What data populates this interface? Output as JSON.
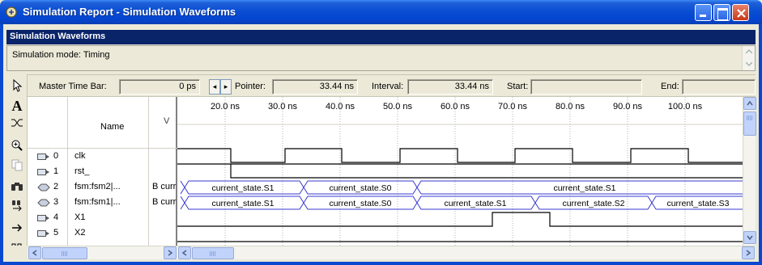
{
  "window": {
    "title": "Simulation Report - Simulation Waveforms"
  },
  "section": {
    "header": "Simulation Waveforms",
    "mode": "Simulation mode: Timing"
  },
  "timebar": {
    "master_label": "Master Time Bar:",
    "master_value": "0 ps",
    "pointer_label": "Pointer:",
    "pointer_value": "33.44 ns",
    "interval_label": "Interval:",
    "interval_value": "33.44 ns",
    "start_label": "Start:",
    "start_value": "",
    "end_label": "End:",
    "end_value": ""
  },
  "table": {
    "name_header": "Name",
    "value_header": "V",
    "rows": [
      {
        "index": "0",
        "name": "clk",
        "value": "",
        "pin": "input"
      },
      {
        "index": "1",
        "name": "rst_",
        "value": "",
        "pin": "input"
      },
      {
        "index": "2",
        "name": "fsm:fsm2|...",
        "value": "B curr",
        "pin": "bidir"
      },
      {
        "index": "3",
        "name": "fsm:fsm1|...",
        "value": "B curr",
        "pin": "bidir"
      },
      {
        "index": "4",
        "name": "X1",
        "value": "",
        "pin": "input"
      },
      {
        "index": "5",
        "name": "X2",
        "value": "",
        "pin": "input"
      }
    ]
  },
  "wave": {
    "time_labels": [
      "20.0 ns",
      "30.0 ns",
      "40.0 ns",
      "50.0 ns",
      "60.0 ns",
      "70.0 ns",
      "80.0 ns",
      "90.0 ns",
      "100.0 ns"
    ],
    "bus_fsm2": [
      "current_state.S1",
      "current_state.S0",
      "current_state.S1"
    ],
    "bus_fsm1": [
      "current_state.S1",
      "current_state.S0",
      "current_state.S1",
      "current_state.S2",
      "current_state.S3"
    ]
  },
  "tools": [
    "pointer-tool-icon",
    "text-tool-icon",
    "waveform-edit-icon",
    "zoom-icon",
    "copy-icon",
    "find-icon",
    "replace-icon",
    "goto-icon",
    "sort-icon"
  ],
  "colors": {
    "titlebar": "#0a4ed3",
    "section_header": "#0a246a",
    "bus_line": "#3a3ad0",
    "grid": "#b0b0b0"
  }
}
